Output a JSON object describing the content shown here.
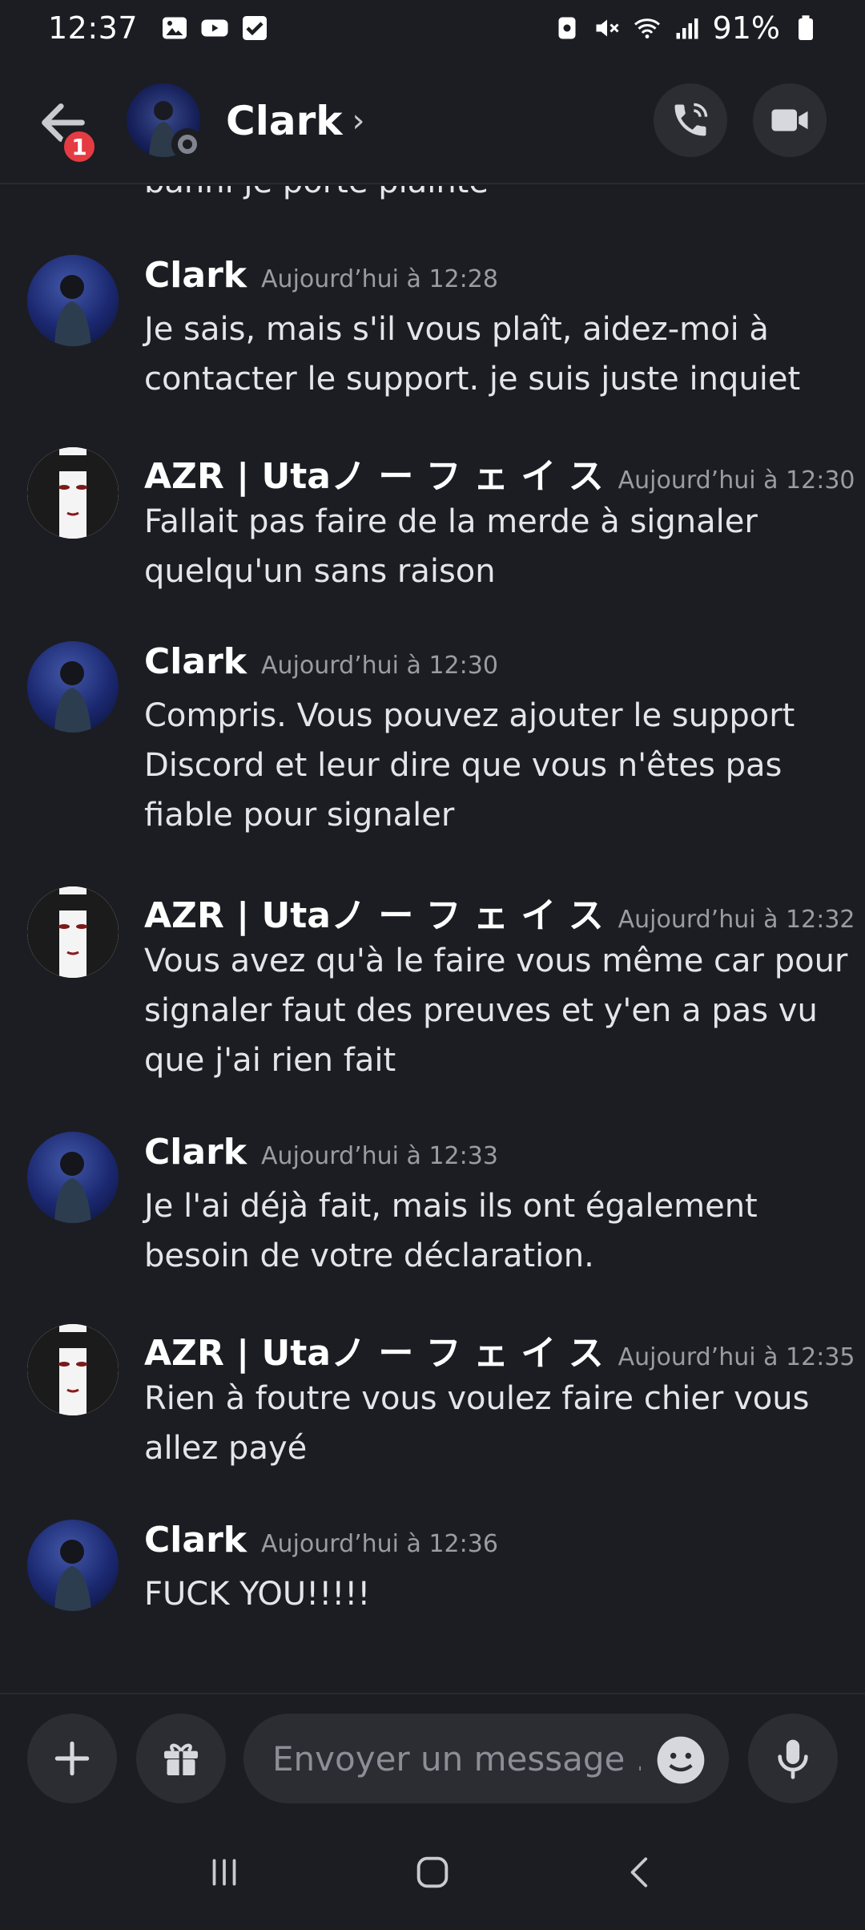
{
  "status_bar": {
    "time": "12:37",
    "battery": "91%"
  },
  "header": {
    "title": "Clark",
    "notification_count": "1"
  },
  "messages": {
    "partial_text": "banni je porte plainte",
    "items": [
      {
        "author": "Clark",
        "time": "Aujourd’hui à 12:28",
        "text": "Je sais, mais s'il vous plaît, aidez-moi à contacter le support. je suis juste inquiet"
      },
      {
        "author": "AZR | Utaノ ー フ ェ イ ス",
        "time": "Aujourd’hui à 12:30",
        "text": "Fallait pas faire de la merde à signaler quelqu'un sans raison"
      },
      {
        "author": "Clark",
        "time": "Aujourd’hui à 12:30",
        "text": "Compris. Vous pouvez ajouter le support Discord et leur dire que vous n'êtes pas fiable pour signaler"
      },
      {
        "author": "AZR | Utaノ ー フ ェ イ ス",
        "time": "Aujourd’hui à 12:32",
        "text": "Vous avez qu'à le faire vous même car pour signaler faut des preuves et y'en a pas vu que j'ai rien fait"
      },
      {
        "author": "Clark",
        "time": "Aujourd’hui à 12:33",
        "text": "Je l'ai déjà fait, mais ils ont également besoin de votre déclaration."
      },
      {
        "author": "AZR | Utaノ ー フ ェ イ ス",
        "time": "Aujourd’hui à 12:35",
        "text": "Rien à foutre vous voulez faire chier vous allez payé"
      },
      {
        "author": "Clark",
        "time": "Aujourd’hui à 12:36",
        "text": "FUCK YOU!!!!!"
      }
    ]
  },
  "composer": {
    "placeholder": "Envoyer un message ..."
  },
  "colors": {
    "background": "#1c1d22",
    "surface": "#2b2d33",
    "badge": "#e53b43"
  }
}
